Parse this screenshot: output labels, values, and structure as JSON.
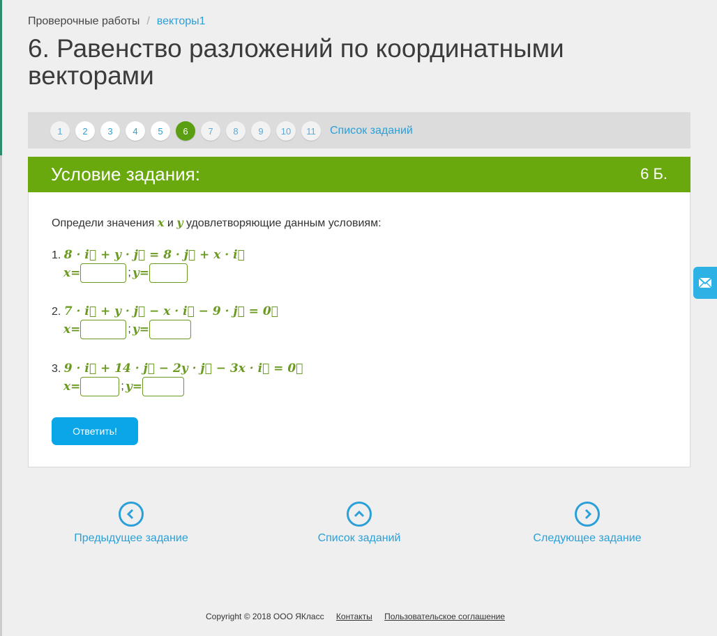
{
  "breadcrumb": {
    "parent": "Проверочные работы",
    "current": "векторы1"
  },
  "title": "6. Равенство разложений по координатными векторами",
  "pager": {
    "items": [
      "1",
      "2",
      "3",
      "4",
      "5",
      "6",
      "7",
      "8",
      "9",
      "10",
      "11"
    ],
    "active": "6",
    "task_list_label": "Список заданий"
  },
  "task": {
    "header": "Условие задания:",
    "points": "6 Б.",
    "intro_before": "Определи значения",
    "intro_var_x": "x",
    "intro_and": "и",
    "intro_var_y": "y",
    "intro_after": "удовлетворяющие данным условиям:",
    "equations": [
      {
        "num": "1.",
        "expr": "8 · i⃗ + y · j⃗ = 8 · j⃗ + x · i⃗"
      },
      {
        "num": "2.",
        "expr": "7 · i⃗ + y · j⃗ − x · i⃗ − 9 · j⃗ = 0⃗"
      },
      {
        "num": "3.",
        "expr": "9 · i⃗ + 14 · j⃗ − 2y · j⃗ − 3x · i⃗ = 0⃗"
      }
    ],
    "x_label": "x=",
    "y_label": "y=",
    "separator": ";",
    "submit_label": "Ответить!"
  },
  "nav": {
    "prev": "Предыдущее задание",
    "list": "Список заданий",
    "next": "Следующее задание"
  },
  "footer": {
    "copyright": "Copyright © 2018 ООО ЯКласс",
    "contacts": "Контакты",
    "agreement": "Пользовательское соглашение"
  },
  "icons": {
    "mail": "envelope-icon",
    "prev": "chevron-left-icon",
    "list": "chevron-up-icon",
    "next": "chevron-right-icon"
  },
  "colors": {
    "accent_green": "#6aa90e",
    "link_blue": "#2b9fd8",
    "button_blue": "#0aa6e8",
    "math_green": "#6a9a1f"
  }
}
